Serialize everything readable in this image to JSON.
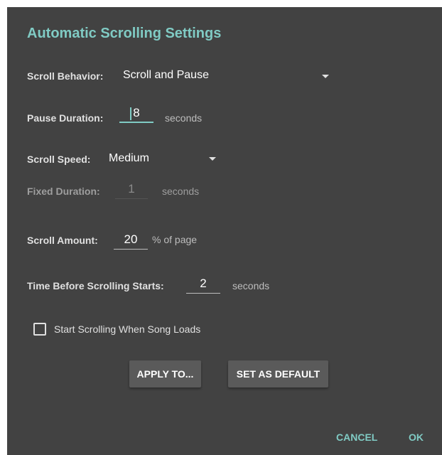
{
  "dialog": {
    "title": "Automatic Scrolling Settings"
  },
  "scroll_behavior": {
    "label": "Scroll Behavior:",
    "value": "Scroll and Pause",
    "icon": "dropdown-arrow-icon"
  },
  "pause_duration": {
    "label": "Pause Duration:",
    "value": "8",
    "unit": "seconds"
  },
  "scroll_speed": {
    "label": "Scroll Speed:",
    "value": "Medium",
    "icon": "dropdown-arrow-icon"
  },
  "fixed_duration": {
    "label": "Fixed Duration:",
    "value": "1",
    "unit": "seconds"
  },
  "scroll_amount": {
    "label": "Scroll Amount:",
    "value": "20",
    "unit": "% of page"
  },
  "time_before_scrolling": {
    "label": "Time Before Scrolling Starts:",
    "value": "2",
    "unit": "seconds"
  },
  "start_on_load": {
    "label": "Start Scrolling When Song Loads",
    "checked": false
  },
  "buttons": {
    "apply_to": "APPLY TO...",
    "set_as_default": "SET AS DEFAULT",
    "cancel": "CANCEL",
    "ok": "OK"
  },
  "colors": {
    "background": "#424242",
    "accent": "#80cbc4",
    "button": "#5a5a5a"
  }
}
